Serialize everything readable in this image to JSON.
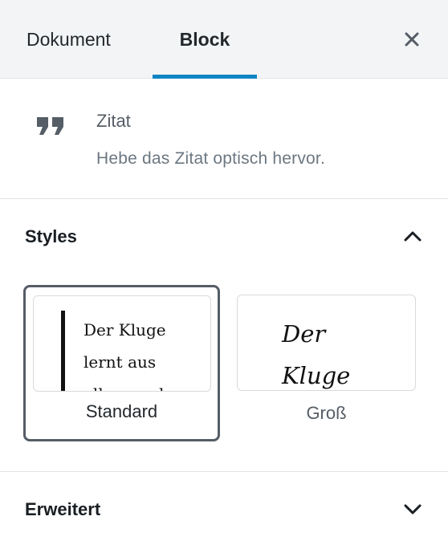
{
  "tabs": {
    "document_label": "Dokument",
    "block_label": "Block",
    "active": "Block",
    "accent_color": "#0e85c4"
  },
  "close": {
    "icon": "close-icon"
  },
  "block_card": {
    "icon": "quote-icon",
    "title": "Zitat",
    "description": "Hebe das Zitat optisch hervor."
  },
  "styles_panel": {
    "title": "Styles",
    "expanded": true,
    "options": [
      {
        "label": "Standard",
        "selected": true,
        "preview_lines": [
          "Der Kluge",
          "lernt aus",
          "allem und"
        ]
      },
      {
        "label": "Groß",
        "selected": false,
        "preview_lines": [
          "Der",
          "Kluge"
        ]
      }
    ]
  },
  "advanced_panel": {
    "title": "Erweitert",
    "expanded": false
  }
}
